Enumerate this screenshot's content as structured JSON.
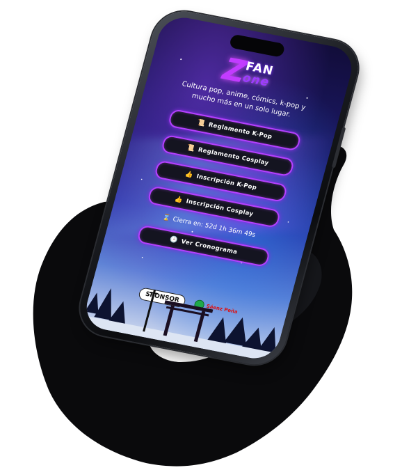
{
  "brand": {
    "logo_letter": "Z",
    "logo_word1": "FAN",
    "logo_word2": "one"
  },
  "tagline": "Cultura pop, anime, cómics, k-pop y mucho más en un solo lugar.",
  "buttons": [
    {
      "icon": "📜",
      "label": "Reglamento K-Pop"
    },
    {
      "icon": "📜",
      "label": "Reglamento Cosplay"
    },
    {
      "icon": "👍",
      "label": "Inscripción K-Pop"
    },
    {
      "icon": "👍",
      "label": "Inscripción Cosplay"
    }
  ],
  "countdown": {
    "icon": "⌛",
    "text": "Cierra en: 52d 1h 36m 49s"
  },
  "schedule_button": {
    "icon": "🕒",
    "label": "Ver Cronograma"
  },
  "sponsor": {
    "label": "SPONSOR",
    "municipio": "Sáenz Peña"
  },
  "colors": {
    "accent": "#b540ff",
    "button_bg": "#141420",
    "logo_purple": "#c23bff",
    "muni_green": "#1fa84a",
    "muni_red": "#dd1111"
  }
}
